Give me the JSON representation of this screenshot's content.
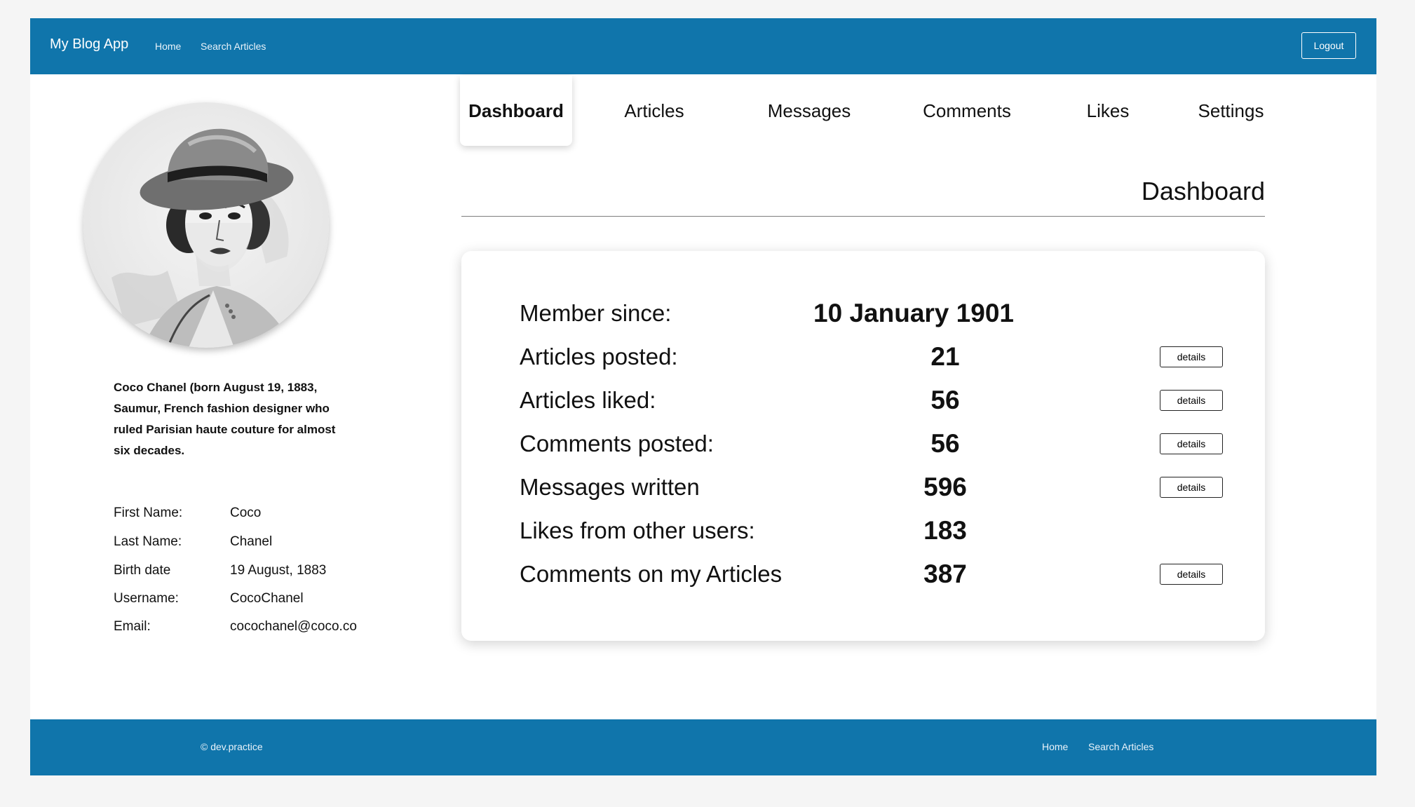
{
  "header": {
    "brand": "My Blog App",
    "nav": [
      "Home",
      "Search Articles"
    ],
    "logout_label": "Logout"
  },
  "profile": {
    "bio": "Coco Chanel (born August 19, 1883, Saumur,  French fashion designer who ruled Parisian haute couture for almost six decades.",
    "fields": [
      {
        "label": "First Name:",
        "value": "Coco"
      },
      {
        "label": "Last Name:",
        "value": "Chanel"
      },
      {
        "label": "Birth date",
        "value": "19 August, 1883"
      },
      {
        "label": "Username:",
        "value": "CocoChanel"
      },
      {
        "label": "Email:",
        "value": "cocochanel@coco.co"
      }
    ]
  },
  "tabs": [
    "Dashboard",
    "Articles",
    "Messages",
    "Comments",
    "Likes",
    "Settings"
  ],
  "active_tab": "Dashboard",
  "dashboard": {
    "title": "Dashboard",
    "stats": [
      {
        "label": "Member since:",
        "value": "10 January 1901",
        "details": ""
      },
      {
        "label": "Articles posted:",
        "value": "21",
        "details": "details"
      },
      {
        "label": "Articles liked:",
        "value": "56",
        "details": "details"
      },
      {
        "label": "Comments posted:",
        "value": "56",
        "details": "details"
      },
      {
        "label": "Messages written",
        "value": "596",
        "details": "details"
      },
      {
        "label": "Likes from other users:",
        "value": "183",
        "details": ""
      },
      {
        "label": "Comments on my Articles",
        "value": "387",
        "details": "details"
      }
    ]
  },
  "footer": {
    "copyright": "© dev.practice",
    "links": [
      "Home",
      "Search Articles"
    ]
  },
  "colors": {
    "brand_blue": "#1075ab",
    "background": "#f5f5f5",
    "surface": "#ffffff"
  }
}
